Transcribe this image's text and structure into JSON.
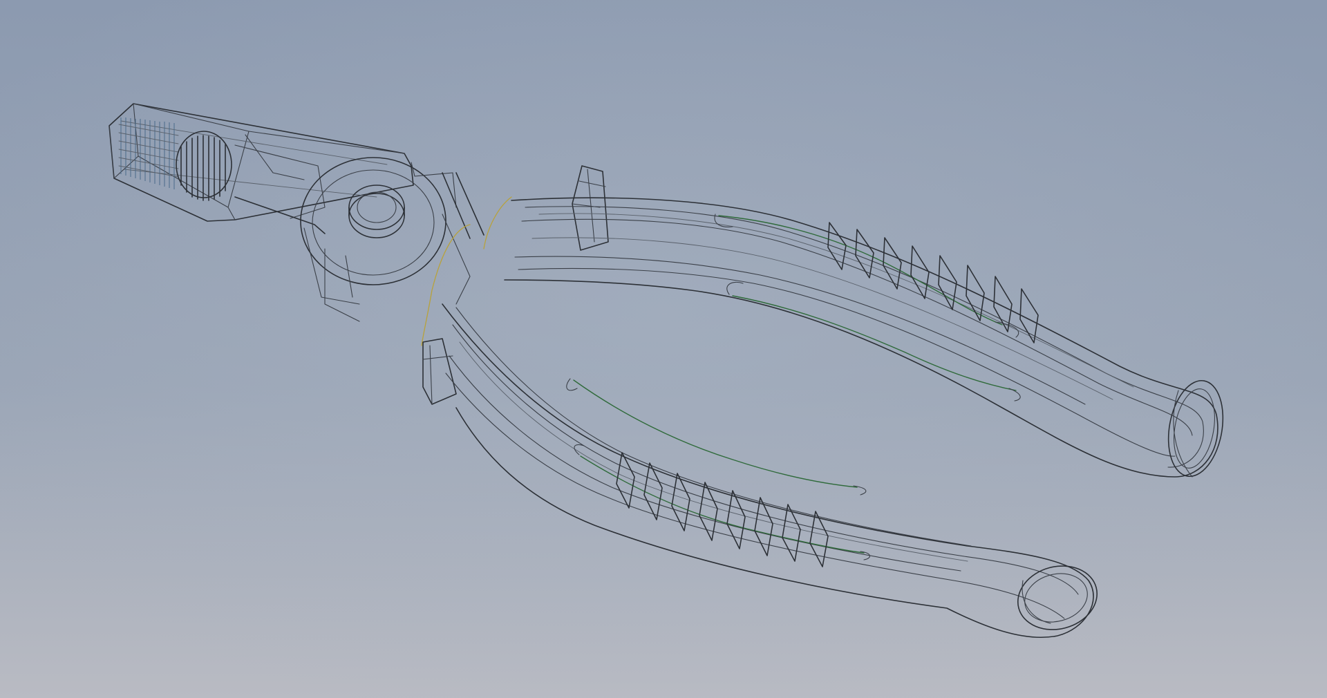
{
  "viewport": {
    "view_style": "wireframe",
    "background": {
      "top_color": "#8c9ab0",
      "mid_color": "#9aa5b6",
      "bottom_color": "#b9bbc3"
    },
    "model": {
      "name_icon": "combination-pliers-wireframe",
      "edge_color": "#3a3f47",
      "highlight_edge_color": "#2f6a3a",
      "selected_edge_color": "#b8a23a"
    }
  }
}
